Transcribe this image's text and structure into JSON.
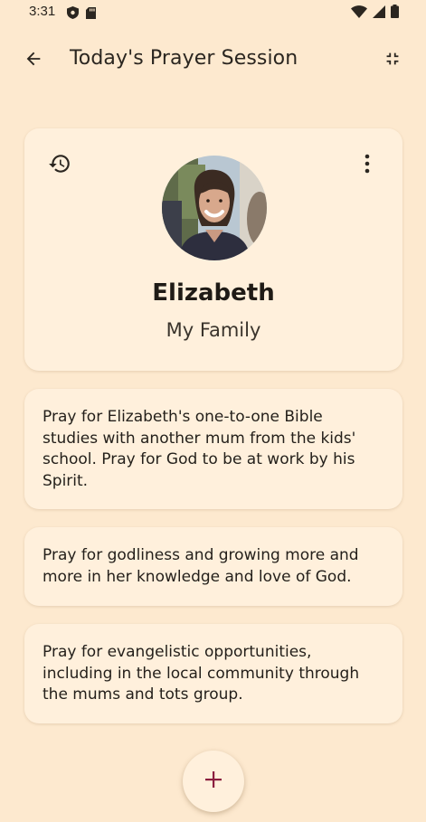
{
  "status_bar": {
    "time": "3:31",
    "left_icons": [
      "shield-icon",
      "sd-card-icon"
    ],
    "right_icons": [
      "wifi-icon",
      "signal-icon",
      "battery-icon"
    ]
  },
  "app_bar": {
    "title": "Today's Prayer Session",
    "back_icon": "arrow-back-icon",
    "collapse_icon": "fullscreen-exit-icon"
  },
  "profile": {
    "name": "Elizabeth",
    "group": "My Family",
    "history_icon": "history-icon",
    "more_icon": "more-vert-icon"
  },
  "prayers": [
    {
      "text": "Pray for Elizabeth's one-to-one Bible studies with another mum from the kids' school. Pray for God to be at work by his Spirit."
    },
    {
      "text": "Pray for godliness and growing more and more in her knowledge and love of God."
    },
    {
      "text": "Pray for evangelistic opportunities, including in the local community through the mums and tots group."
    }
  ],
  "fab": {
    "icon": "add-icon"
  },
  "colors": {
    "background": "#fde9cf",
    "card": "#fff0dc",
    "accent": "#8b1e3f"
  }
}
